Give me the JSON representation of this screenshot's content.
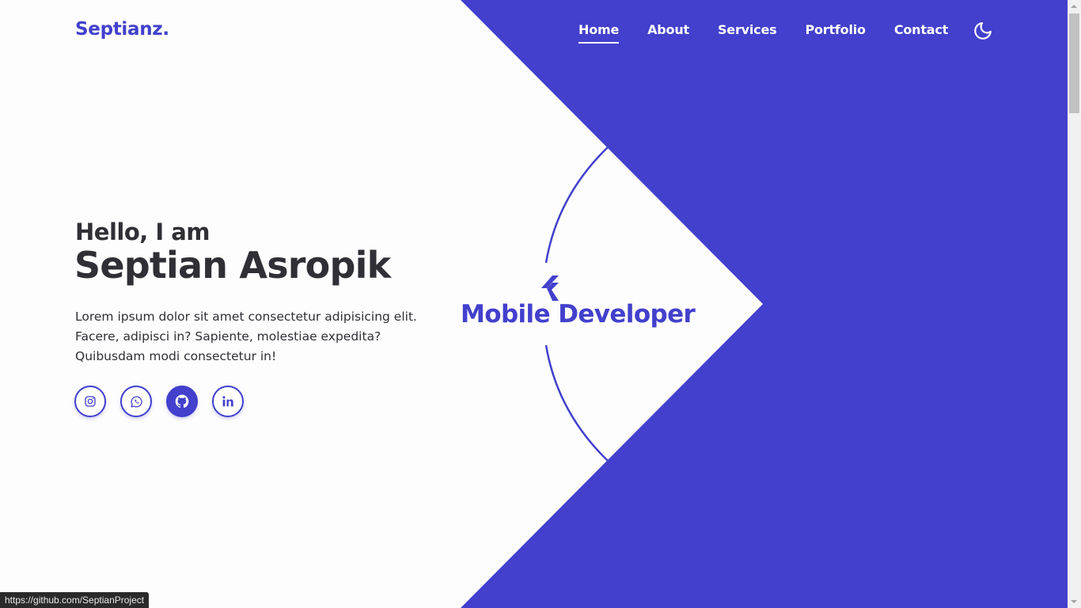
{
  "colors": {
    "accent": "#4240cc",
    "text_dark": "#2f2f35",
    "background": "#fdfdfd",
    "nav_text": "#ffffff"
  },
  "header": {
    "logo": "Septianz.",
    "nav": [
      {
        "label": "Home",
        "active": true
      },
      {
        "label": "About",
        "active": false
      },
      {
        "label": "Services",
        "active": false
      },
      {
        "label": "Portfolio",
        "active": false
      },
      {
        "label": "Contact",
        "active": false
      }
    ],
    "theme_toggle_icon": "moon-icon"
  },
  "hero": {
    "greeting": "Hello, I am",
    "name": "Septian Asropik",
    "description": "Lorem ipsum dolor sit amet consectetur adipisicing elit. Facere, adipisci in? Sapiente, molestiae expedita? Quibusdam modi consectetur in!",
    "socials": [
      {
        "icon": "instagram-icon",
        "hovered": false
      },
      {
        "icon": "whatsapp-icon",
        "hovered": false
      },
      {
        "icon": "github-icon",
        "hovered": true
      },
      {
        "icon": "linkedin-icon",
        "hovered": false
      }
    ],
    "role_icon": "flutter-icon",
    "role": "Mobile Developer"
  },
  "status_bar": {
    "url": "https://github.com/SeptianProject"
  }
}
